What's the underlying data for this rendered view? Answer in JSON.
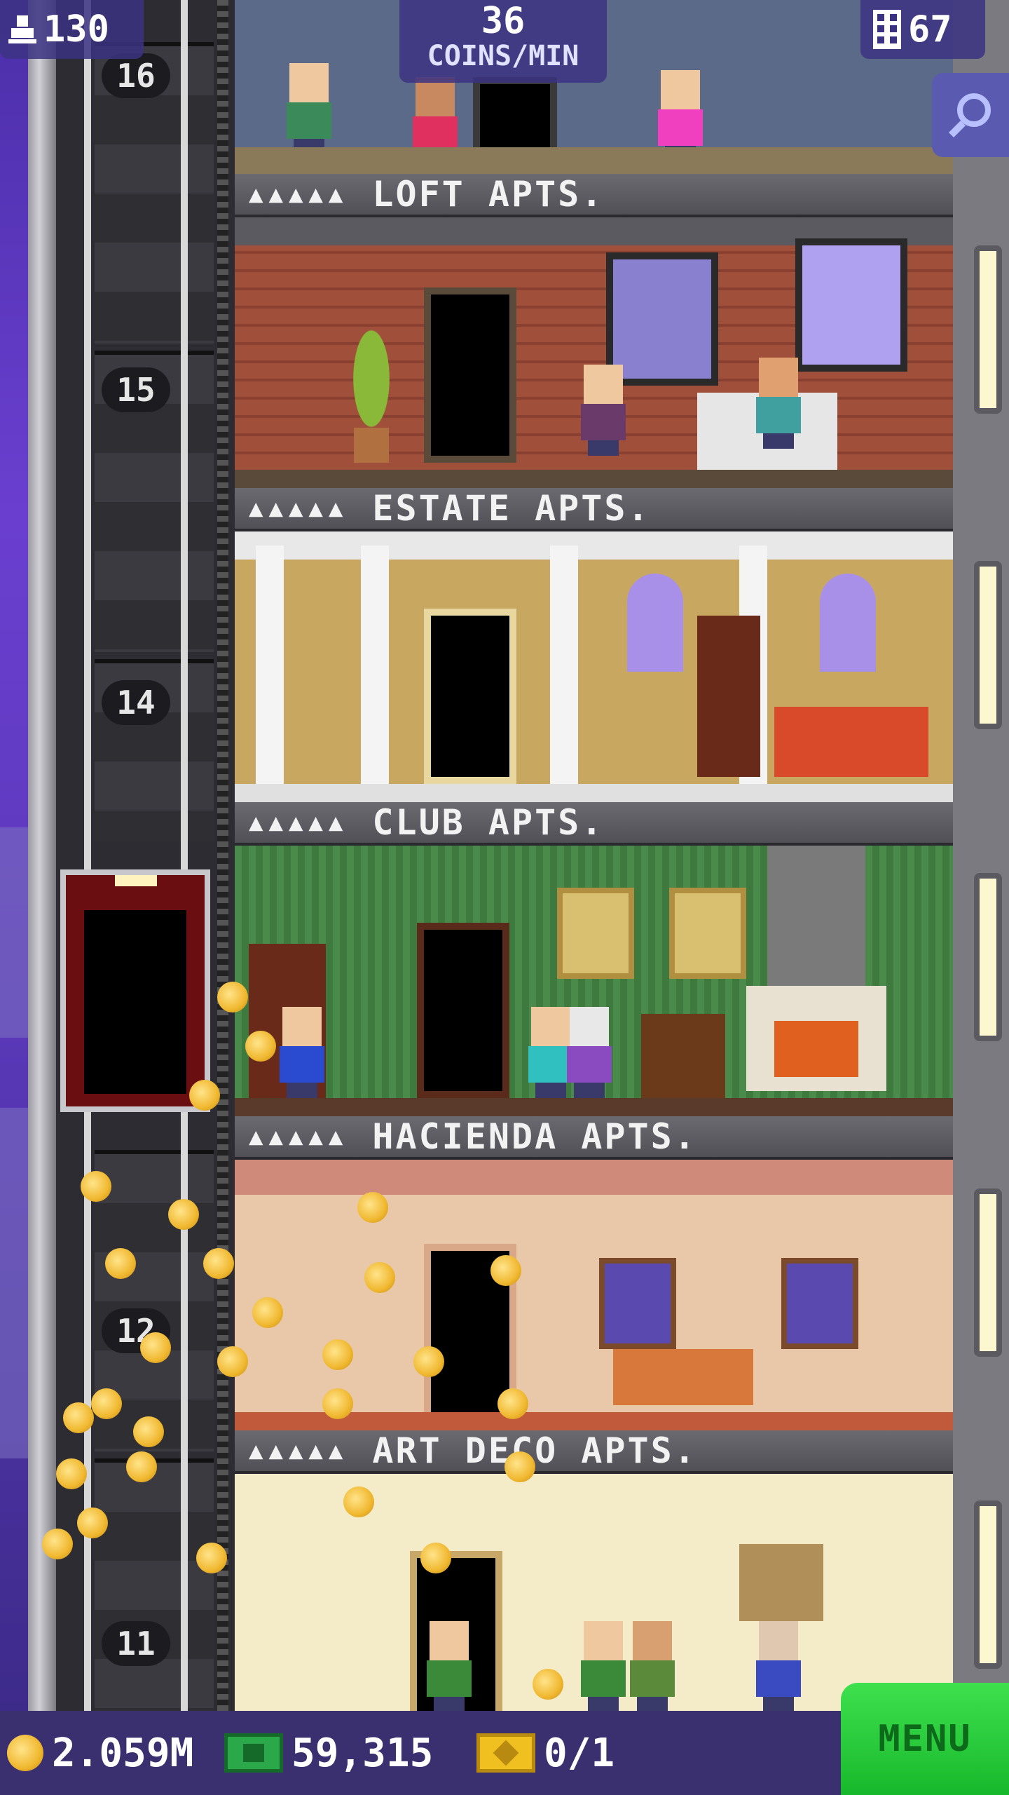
{
  "hud": {
    "population": "130",
    "coins_per_min_value": "36",
    "coins_per_min_label": "COINS/MIN",
    "floors": "67",
    "search_icon": "magnifier-icon"
  },
  "shaft": {
    "floor_numbers": [
      "16",
      "15",
      "14",
      "12",
      "11"
    ]
  },
  "floors": [
    {
      "name": "LOFT APTS.",
      "stars": "▲▲▲▲▲"
    },
    {
      "name": "ESTATE APTS.",
      "stars": "▲▲▲▲▲"
    },
    {
      "name": "CLUB APTS.",
      "stars": "▲▲▲▲▲"
    },
    {
      "name": "HACIENDA APTS.",
      "stars": "▲▲▲▲▲"
    },
    {
      "name": "ART DECO APTS.",
      "stars": "▲▲▲▲▲"
    }
  ],
  "bottom_bar": {
    "coins": "2.059M",
    "bux": "59,315",
    "vip": "0/1",
    "menu_label": "MENU"
  },
  "colors": {
    "menu_green": "#2ed040",
    "hud_purple": "#3c3282",
    "loft_wall": "#a0503a",
    "estate_wall": "#c8a860",
    "club_wall": "#4a8a4a",
    "hacienda_wall": "#e8c8a8",
    "artdeco_wall": "#f4ecc8"
  }
}
